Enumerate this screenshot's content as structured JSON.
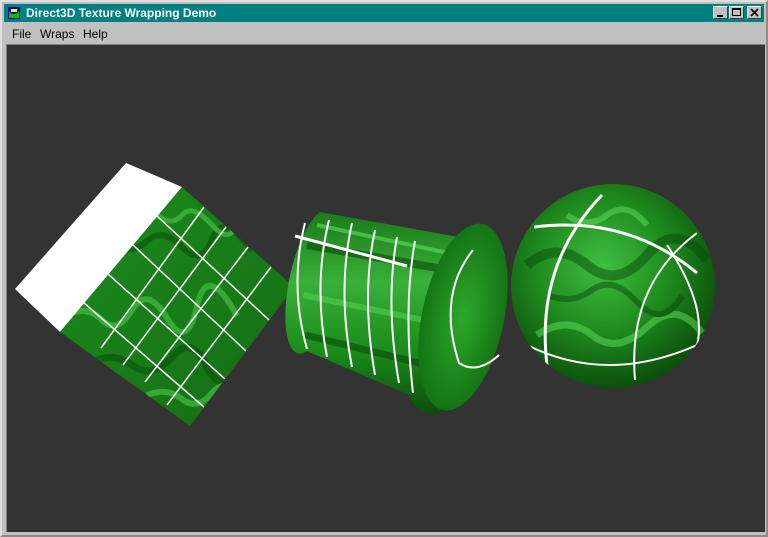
{
  "window": {
    "title": "Direct3D Texture Wrapping Demo",
    "controls": [
      "minimize",
      "maximize",
      "close"
    ]
  },
  "menu": {
    "items": [
      "File",
      "Wraps",
      "Help"
    ]
  },
  "scene": {
    "background": "#333333",
    "objects": [
      "cube",
      "cylinder",
      "sphere"
    ],
    "texture_color": "#1f8a1f",
    "line_color": "#ffffff"
  }
}
